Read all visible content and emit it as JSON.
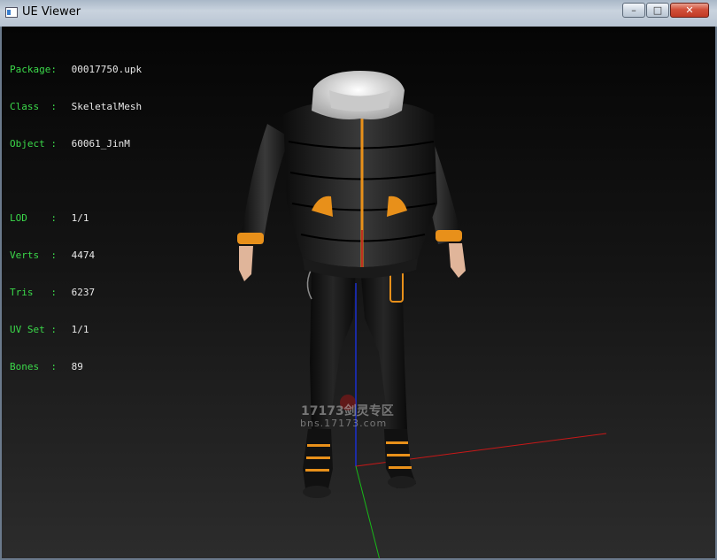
{
  "window": {
    "title": "UE Viewer",
    "controls": {
      "minimize": "–",
      "maximize": "□",
      "close": "✕"
    }
  },
  "info": {
    "package": {
      "label": "Package:",
      "value": "00017750.upk"
    },
    "class": {
      "label": "Class  :",
      "value": "SkeletalMesh"
    },
    "object": {
      "label": "Object :",
      "value": "60061_JinM"
    },
    "lod": {
      "label": "LOD    :",
      "value": "1/1"
    },
    "verts": {
      "label": "Verts  :",
      "value": "4474"
    },
    "tris": {
      "label": "Tris   :",
      "value": "6237"
    },
    "uvset": {
      "label": "UV Set :",
      "value": "1/1"
    },
    "bones": {
      "label": "Bones  :",
      "value": "89"
    }
  },
  "watermark": {
    "line1": "17173剑灵专区",
    "line2": "bns.17173.com"
  },
  "colors": {
    "axis_x": "#c81818",
    "axis_y": "#1a2fd0",
    "axis_z": "#18b818",
    "label_key": "#3bd94a",
    "label_value": "#e8e8e8",
    "accent_orange": "#e8901a"
  }
}
